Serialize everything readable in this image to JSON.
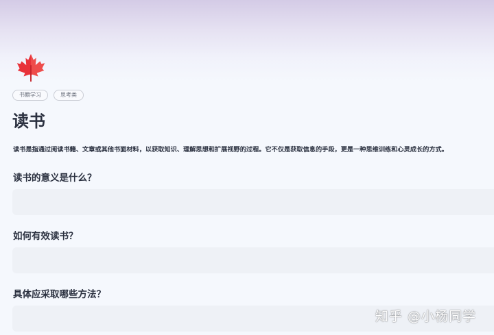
{
  "cover": {
    "icon": "maple-leaf-icon",
    "icon_color": "#e8323a",
    "icon_color_light": "#f3625a"
  },
  "tags": [
    "书籍学习",
    "思考类"
  ],
  "page": {
    "title": "读书",
    "intro": "读书是指通过阅读书籍、文章或其他书面材料，以获取知识、理解思想和扩展视野的过程。它不仅是获取信息的手段，更是一种思维训练和心灵成长的方式。"
  },
  "questions": [
    {
      "heading": "读书的意义是什么？",
      "answer": ""
    },
    {
      "heading": "如何有效读书？",
      "answer": ""
    },
    {
      "heading": "具体应采取哪些方法？",
      "answer": ""
    }
  ],
  "watermark": "知乎 @小杨同学"
}
